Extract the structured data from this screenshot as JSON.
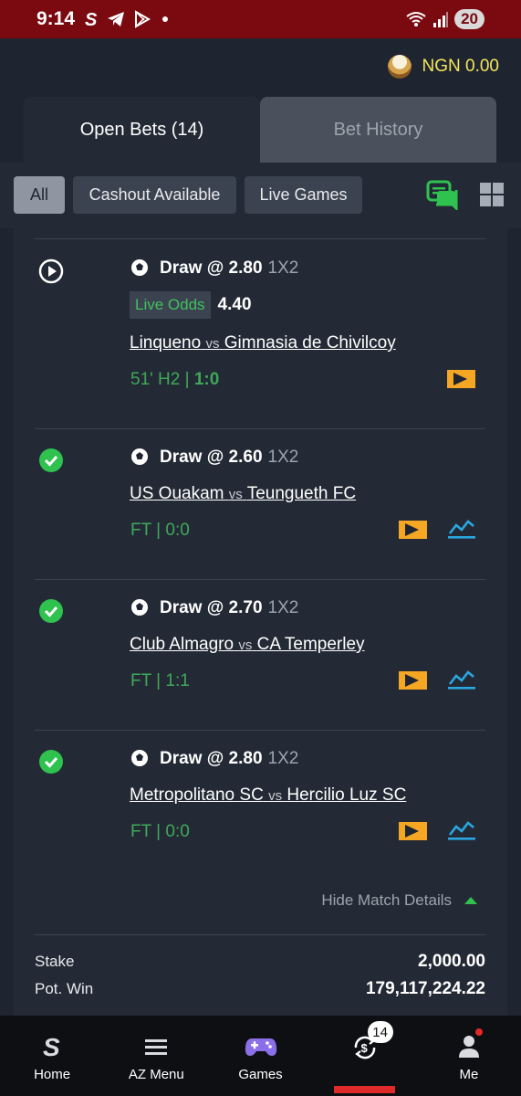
{
  "status_bar": {
    "time": "9:14",
    "battery": "20"
  },
  "header": {
    "currency": "NGN",
    "balance": "0.00",
    "balance_text": "NGN 0.00"
  },
  "tabs": [
    {
      "label": "Open Bets (14)",
      "active": true
    },
    {
      "label": "Bet History",
      "active": false
    }
  ],
  "filters": [
    {
      "label": "All",
      "selected": true
    },
    {
      "label": "Cashout Available",
      "selected": false
    },
    {
      "label": "Live Games",
      "selected": false
    }
  ],
  "legs": [
    {
      "status": "live",
      "pick": "Draw @ 2.80",
      "market": "1X2",
      "live_odds_label": "Live Odds",
      "live_odds_value": "4.40",
      "home": "Linqueno",
      "vs": "vs",
      "away": "Gimnasia de Chivilcoy",
      "score_prefix": "51' H2 | ",
      "score_value": "1:0",
      "has_stats": false
    },
    {
      "status": "won",
      "pick": "Draw @ 2.60",
      "market": "1X2",
      "home": "US Ouakam",
      "vs": "vs",
      "away": "Teungueth FC",
      "score_prefix": "FT | ",
      "score_value": "0:0",
      "has_stats": true
    },
    {
      "status": "won",
      "pick": "Draw @ 2.70",
      "market": "1X2",
      "home": "Club Almagro",
      "vs": "vs",
      "away": "CA Temperley",
      "score_prefix": "FT | ",
      "score_value": "1:1",
      "has_stats": true
    },
    {
      "status": "won",
      "pick": "Draw @ 2.80",
      "market": "1X2",
      "home": "Metropolitano SC",
      "vs": "vs",
      "away": "Hercilio Luz SC",
      "score_prefix": "FT | ",
      "score_value": "0:0",
      "has_stats": true
    }
  ],
  "details_toggle": "Hide Match Details",
  "summary": {
    "stake_label": "Stake",
    "stake_value": "2,000.00",
    "pot_win_label": "Pot. Win",
    "pot_win_value": "179,117,224.22"
  },
  "bottom_nav": [
    {
      "label": "Home",
      "icon": "stake-logo-icon"
    },
    {
      "label": "AZ Menu",
      "icon": "hamburger-menu-icon"
    },
    {
      "label": "Games",
      "icon": "gamepad-icon"
    },
    {
      "label": "",
      "icon": "bets-dollar-icon",
      "badge": "14",
      "active": true
    },
    {
      "label": "Me",
      "icon": "user-icon",
      "notification_dot": true
    }
  ],
  "colors": {
    "status_bar": "#7a0a10",
    "background": "#1f2530",
    "card": "#232a36",
    "accent_green": "#3fa858",
    "balance_yellow": "#f4e55c",
    "stream_orange": "#f5a623",
    "stats_blue": "#2aa7e0",
    "active_red": "#e02a2a"
  }
}
